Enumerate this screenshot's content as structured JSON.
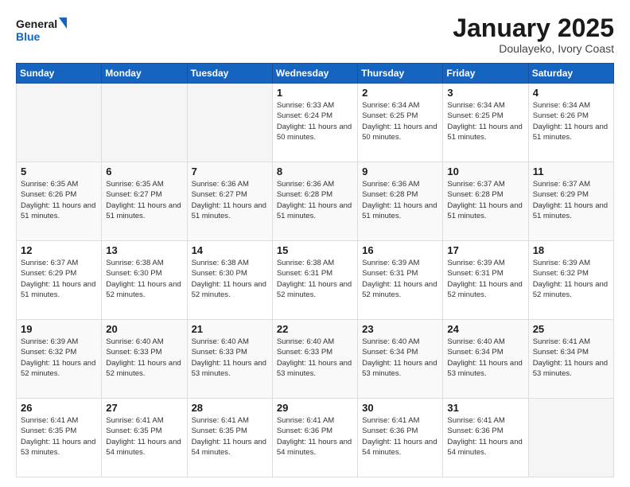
{
  "header": {
    "title": "January 2025",
    "subtitle": "Doulayeko, Ivory Coast",
    "logo_line1": "General",
    "logo_line2": "Blue"
  },
  "days_of_week": [
    "Sunday",
    "Monday",
    "Tuesday",
    "Wednesday",
    "Thursday",
    "Friday",
    "Saturday"
  ],
  "weeks": [
    [
      {
        "day": "",
        "info": ""
      },
      {
        "day": "",
        "info": ""
      },
      {
        "day": "",
        "info": ""
      },
      {
        "day": "1",
        "info": "Sunrise: 6:33 AM\nSunset: 6:24 PM\nDaylight: 11 hours and 50 minutes."
      },
      {
        "day": "2",
        "info": "Sunrise: 6:34 AM\nSunset: 6:25 PM\nDaylight: 11 hours and 50 minutes."
      },
      {
        "day": "3",
        "info": "Sunrise: 6:34 AM\nSunset: 6:25 PM\nDaylight: 11 hours and 51 minutes."
      },
      {
        "day": "4",
        "info": "Sunrise: 6:34 AM\nSunset: 6:26 PM\nDaylight: 11 hours and 51 minutes."
      }
    ],
    [
      {
        "day": "5",
        "info": "Sunrise: 6:35 AM\nSunset: 6:26 PM\nDaylight: 11 hours and 51 minutes."
      },
      {
        "day": "6",
        "info": "Sunrise: 6:35 AM\nSunset: 6:27 PM\nDaylight: 11 hours and 51 minutes."
      },
      {
        "day": "7",
        "info": "Sunrise: 6:36 AM\nSunset: 6:27 PM\nDaylight: 11 hours and 51 minutes."
      },
      {
        "day": "8",
        "info": "Sunrise: 6:36 AM\nSunset: 6:28 PM\nDaylight: 11 hours and 51 minutes."
      },
      {
        "day": "9",
        "info": "Sunrise: 6:36 AM\nSunset: 6:28 PM\nDaylight: 11 hours and 51 minutes."
      },
      {
        "day": "10",
        "info": "Sunrise: 6:37 AM\nSunset: 6:28 PM\nDaylight: 11 hours and 51 minutes."
      },
      {
        "day": "11",
        "info": "Sunrise: 6:37 AM\nSunset: 6:29 PM\nDaylight: 11 hours and 51 minutes."
      }
    ],
    [
      {
        "day": "12",
        "info": "Sunrise: 6:37 AM\nSunset: 6:29 PM\nDaylight: 11 hours and 51 minutes."
      },
      {
        "day": "13",
        "info": "Sunrise: 6:38 AM\nSunset: 6:30 PM\nDaylight: 11 hours and 52 minutes."
      },
      {
        "day": "14",
        "info": "Sunrise: 6:38 AM\nSunset: 6:30 PM\nDaylight: 11 hours and 52 minutes."
      },
      {
        "day": "15",
        "info": "Sunrise: 6:38 AM\nSunset: 6:31 PM\nDaylight: 11 hours and 52 minutes."
      },
      {
        "day": "16",
        "info": "Sunrise: 6:39 AM\nSunset: 6:31 PM\nDaylight: 11 hours and 52 minutes."
      },
      {
        "day": "17",
        "info": "Sunrise: 6:39 AM\nSunset: 6:31 PM\nDaylight: 11 hours and 52 minutes."
      },
      {
        "day": "18",
        "info": "Sunrise: 6:39 AM\nSunset: 6:32 PM\nDaylight: 11 hours and 52 minutes."
      }
    ],
    [
      {
        "day": "19",
        "info": "Sunrise: 6:39 AM\nSunset: 6:32 PM\nDaylight: 11 hours and 52 minutes."
      },
      {
        "day": "20",
        "info": "Sunrise: 6:40 AM\nSunset: 6:33 PM\nDaylight: 11 hours and 52 minutes."
      },
      {
        "day": "21",
        "info": "Sunrise: 6:40 AM\nSunset: 6:33 PM\nDaylight: 11 hours and 53 minutes."
      },
      {
        "day": "22",
        "info": "Sunrise: 6:40 AM\nSunset: 6:33 PM\nDaylight: 11 hours and 53 minutes."
      },
      {
        "day": "23",
        "info": "Sunrise: 6:40 AM\nSunset: 6:34 PM\nDaylight: 11 hours and 53 minutes."
      },
      {
        "day": "24",
        "info": "Sunrise: 6:40 AM\nSunset: 6:34 PM\nDaylight: 11 hours and 53 minutes."
      },
      {
        "day": "25",
        "info": "Sunrise: 6:41 AM\nSunset: 6:34 PM\nDaylight: 11 hours and 53 minutes."
      }
    ],
    [
      {
        "day": "26",
        "info": "Sunrise: 6:41 AM\nSunset: 6:35 PM\nDaylight: 11 hours and 53 minutes."
      },
      {
        "day": "27",
        "info": "Sunrise: 6:41 AM\nSunset: 6:35 PM\nDaylight: 11 hours and 54 minutes."
      },
      {
        "day": "28",
        "info": "Sunrise: 6:41 AM\nSunset: 6:35 PM\nDaylight: 11 hours and 54 minutes."
      },
      {
        "day": "29",
        "info": "Sunrise: 6:41 AM\nSunset: 6:36 PM\nDaylight: 11 hours and 54 minutes."
      },
      {
        "day": "30",
        "info": "Sunrise: 6:41 AM\nSunset: 6:36 PM\nDaylight: 11 hours and 54 minutes."
      },
      {
        "day": "31",
        "info": "Sunrise: 6:41 AM\nSunset: 6:36 PM\nDaylight: 11 hours and 54 minutes."
      },
      {
        "day": "",
        "info": ""
      }
    ]
  ]
}
